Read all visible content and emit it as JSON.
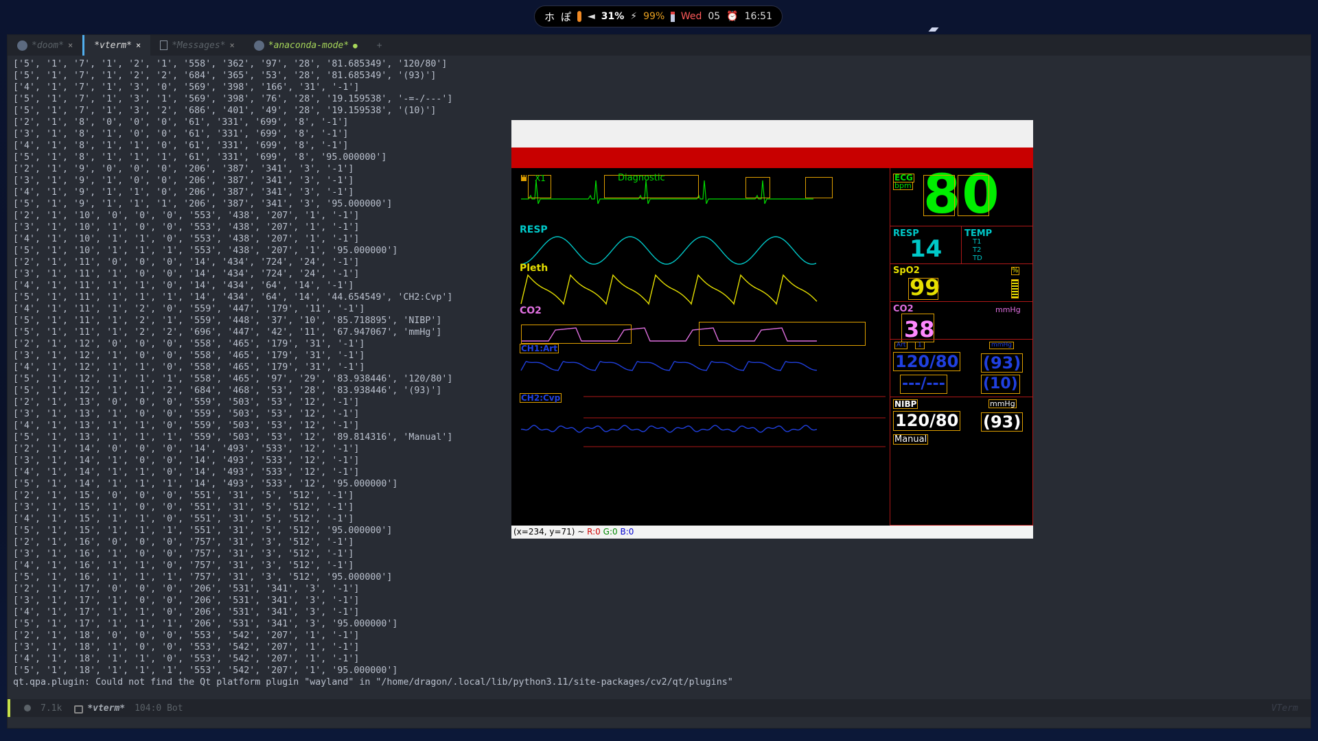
{
  "statusbar": {
    "workspace1": "ホ",
    "workspace2": "ぽ",
    "volume": "31%",
    "battery": "99%",
    "day": "Wed",
    "date": "05",
    "time": "16:51",
    "icons": [
      "wifi-icon",
      "speaker-icon",
      "battery-plug-icon",
      "calendar-icon",
      "alarm-clock-icon"
    ]
  },
  "tabs": [
    {
      "label": "*doom*",
      "close": "×"
    },
    {
      "label": "*vterm*",
      "close": "×"
    },
    {
      "label": "*Messages*",
      "close": "×"
    },
    {
      "label": "*anaconda-mode*",
      "modified": "●"
    },
    {
      "label": "+"
    }
  ],
  "terminal": {
    "lines": [
      "['5', '1', '7', '1', '2', '1', '558', '362', '97', '28', '81.685349', '120/80']",
      "['5', '1', '7', '1', '2', '2', '684', '365', '53', '28', '81.685349', '(93)']",
      "['4', '1', '7', '1', '3', '0', '569', '398', '166', '31', '-1']",
      "['5', '1', '7', '1', '3', '1', '569', '398', '76', '28', '19.159538', '-=-/---']",
      "['5', '1', '7', '1', '3', '2', '686', '401', '49', '28', '19.159538', '(10)']",
      "['2', '1', '8', '0', '0', '0', '61', '331', '699', '8', '-1']",
      "['3', '1', '8', '1', '0', '0', '61', '331', '699', '8', '-1']",
      "['4', '1', '8', '1', '1', '0', '61', '331', '699', '8', '-1']",
      "['5', '1', '8', '1', '1', '1', '61', '331', '699', '8', '95.000000']",
      "['2', '1', '9', '0', '0', '0', '206', '387', '341', '3', '-1']",
      "['3', '1', '9', '1', '0', '0', '206', '387', '341', '3', '-1']",
      "['4', '1', '9', '1', '1', '0', '206', '387', '341', '3', '-1']",
      "['5', '1', '9', '1', '1', '1', '206', '387', '341', '3', '95.000000']",
      "['2', '1', '10', '0', '0', '0', '553', '438', '207', '1', '-1']",
      "['3', '1', '10', '1', '0', '0', '553', '438', '207', '1', '-1']",
      "['4', '1', '10', '1', '1', '0', '553', '438', '207', '1', '-1']",
      "['5', '1', '10', '1', '1', '1', '553', '438', '207', '1', '95.000000']",
      "['2', '1', '11', '0', '0', '0', '14', '434', '724', '24', '-1']",
      "['3', '1', '11', '1', '0', '0', '14', '434', '724', '24', '-1']",
      "['4', '1', '11', '1', '1', '0', '14', '434', '64', '14', '-1']",
      "['5', '1', '11', '1', '1', '1', '14', '434', '64', '14', '44.654549', 'CH2:Cvp']",
      "['4', '1', '11', '1', '2', '0', '559', '447', '179', '11', '-1']",
      "['5', '1', '11', '1', '2', '1', '559', '448', '37', '10', '85.718895', 'NIBP']",
      "['5', '1', '11', '1', '2', '2', '696', '447', '42', '11', '67.947067', 'mmHg']",
      "['2', '1', '12', '0', '0', '0', '558', '465', '179', '31', '-1']",
      "['3', '1', '12', '1', '0', '0', '558', '465', '179', '31', '-1']",
      "['4', '1', '12', '1', '1', '0', '558', '465', '179', '31', '-1']",
      "['5', '1', '12', '1', '1', '1', '558', '465', '97', '29', '83.938446', '120/80']",
      "['5', '1', '12', '1', '1', '2', '684', '468', '53', '28', '83.938446', '(93)']",
      "['2', '1', '13', '0', '0', '0', '559', '503', '53', '12', '-1']",
      "['3', '1', '13', '1', '0', '0', '559', '503', '53', '12', '-1']",
      "['4', '1', '13', '1', '1', '0', '559', '503', '53', '12', '-1']",
      "['5', '1', '13', '1', '1', '1', '559', '503', '53', '12', '89.814316', 'Manual']",
      "['2', '1', '14', '0', '0', '0', '14', '493', '533', '12', '-1']",
      "['3', '1', '14', '1', '0', '0', '14', '493', '533', '12', '-1']",
      "['4', '1', '14', '1', '1', '0', '14', '493', '533', '12', '-1']",
      "['5', '1', '14', '1', '1', '1', '14', '493', '533', '12', '95.000000']",
      "['2', '1', '15', '0', '0', '0', '551', '31', '5', '512', '-1']",
      "['3', '1', '15', '1', '0', '0', '551', '31', '5', '512', '-1']",
      "['4', '1', '15', '1', '1', '0', '551', '31', '5', '512', '-1']",
      "['5', '1', '15', '1', '1', '1', '551', '31', '5', '512', '95.000000']",
      "['2', '1', '16', '0', '0', '0', '757', '31', '3', '512', '-1']",
      "['3', '1', '16', '1', '0', '0', '757', '31', '3', '512', '-1']",
      "['4', '1', '16', '1', '1', '0', '757', '31', '3', '512', '-1']",
      "['5', '1', '16', '1', '1', '1', '757', '31', '3', '512', '95.000000']",
      "['2', '1', '17', '0', '0', '0', '206', '531', '341', '3', '-1']",
      "['3', '1', '17', '1', '0', '0', '206', '531', '341', '3', '-1']",
      "['4', '1', '17', '1', '1', '0', '206', '531', '341', '3', '-1']",
      "['5', '1', '17', '1', '1', '1', '206', '531', '341', '3', '95.000000']",
      "['2', '1', '18', '0', '0', '0', '553', '542', '207', '1', '-1']",
      "['3', '1', '18', '1', '0', '0', '553', '542', '207', '1', '-1']",
      "['4', '1', '18', '1', '1', '0', '553', '542', '207', '1', '-1']",
      "['5', '1', '18', '1', '1', '1', '553', '542', '207', '1', '95.000000']",
      "qt.qpa.plugin: Could not find the Qt platform plugin \"wayland\" in \"/home/dragon/.local/lib/python3.11/site-packages/cv2/qt/plugins\""
    ]
  },
  "modeline": {
    "size": "7.1k",
    "buffer": "*vterm*",
    "position": "104:0 Bot",
    "mode": "VTerm"
  },
  "monitor": {
    "ecg_lead": "II",
    "ecg_x1": "X1",
    "ecg_mode": "Diagnostic",
    "resp_label": "RESP",
    "pleth_label": "Pleth",
    "co2_label": "CO2",
    "ch1_label": "CH1:Art",
    "ch2_label": "CH2:Cvp",
    "hr_label": "ECG",
    "hr_unit": "bpm",
    "hr_value": "80",
    "resp_param_label": "RESP",
    "resp_value": "14",
    "temp_label": "TEMP",
    "t1": "T1",
    "t2": "T2",
    "td": "TD",
    "spo2_label": "SpO2",
    "spo2_unit": "%",
    "spo2_value": "99",
    "co2_param_label": "CO2",
    "co2_unit": "mmHg",
    "co2_value": "38",
    "art_tag1": "Art",
    "art_tag2": "1",
    "art_unit": "mmHg",
    "art_value": "120/80",
    "art_mean": "(93)",
    "cvp_value": "---/---",
    "cvp_mean": "(10)",
    "nibp_label": "NIBP",
    "nibp_unit": "mmHg",
    "nibp_value": "120/80",
    "nibp_mean": "(93)",
    "nibp_mode": "Manual",
    "status_coords": "(x=234, y=71) ~ ",
    "status_r": "R:0",
    "status_g": "G:0",
    "status_b": "B:0"
  },
  "colors": {
    "ecg": "#00dd00",
    "resp": "#00c8c8",
    "pleth": "#e6e000",
    "co2": "#e070e0",
    "art": "#2040e0",
    "box": "#e0a000",
    "panel_border": "#b01818",
    "alarm_bar": "#c80000"
  }
}
